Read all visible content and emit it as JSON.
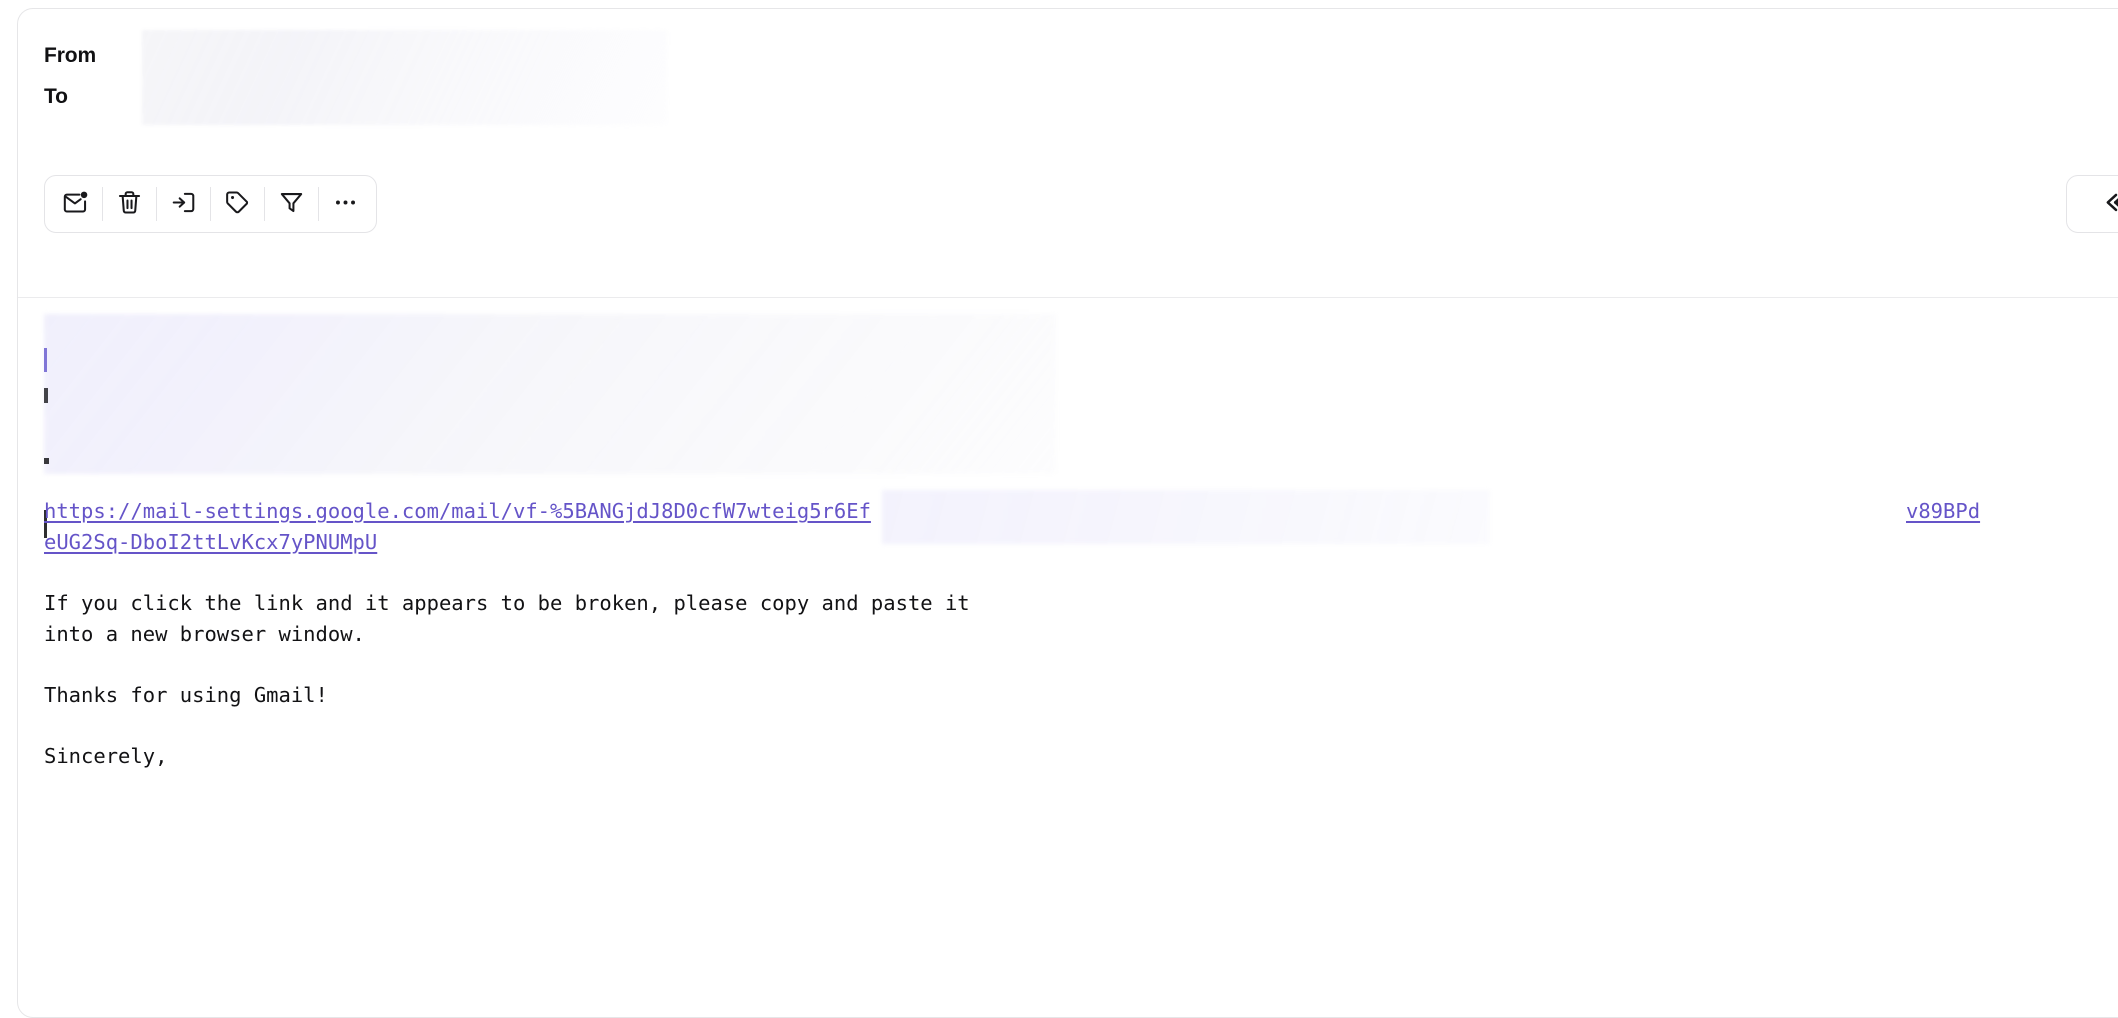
{
  "card": {
    "header": {
      "fields": [
        {
          "label": "From",
          "value_redacted": true
        },
        {
          "label": "To",
          "value_redacted": true
        }
      ],
      "star": {
        "name": "star-icon",
        "active": false
      }
    },
    "toolbar": {
      "buttons": [
        {
          "icon": "mark-unread-icon",
          "label": "Mark as unread"
        },
        {
          "icon": "trash-icon",
          "label": "Delete"
        },
        {
          "icon": "archive-icon",
          "label": "Move to"
        },
        {
          "icon": "tag-icon",
          "label": "Label"
        },
        {
          "icon": "filter-icon",
          "label": "Filter"
        },
        {
          "icon": "more-icon",
          "label": "More"
        }
      ]
    },
    "reply": {
      "icon": "reply-icon",
      "label": "Reply"
    }
  },
  "body": {
    "intro_redacted": true,
    "link": {
      "line1": "https://mail-settings.google.com/mail/vf-%5BANGjdJ8D0cfW7wteig5r6Ef",
      "line1_tail": "v89BPd",
      "line2": "eUG2Sq-DboI2ttLvKcx7yPNUMpU",
      "color": "#6554c8"
    },
    "paragraphs": [
      "If you click the link and it appears to be broken, please copy and paste it\ninto a new browser window.",
      "Thanks for using Gmail!",
      "Sincerely,"
    ]
  },
  "colors": {
    "link": "#6554c8",
    "text": "#121214",
    "border": "#e4e4e7",
    "divider": "#ebebed",
    "background": "#ffffff"
  }
}
